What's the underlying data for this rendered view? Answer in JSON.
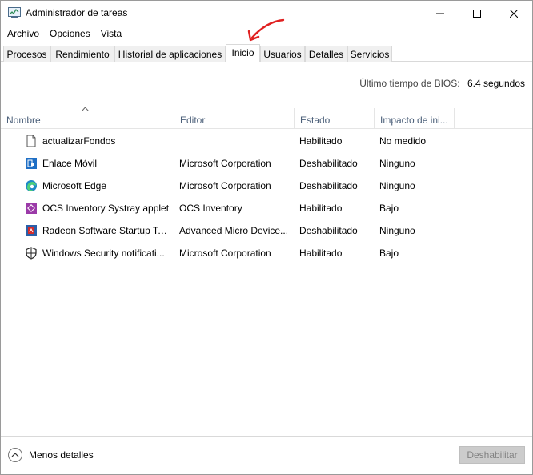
{
  "window": {
    "title": "Administrador de tareas",
    "icon": "task-manager-icon"
  },
  "menu": [
    "Archivo",
    "Opciones",
    "Vista"
  ],
  "tabs": [
    {
      "label": "Procesos"
    },
    {
      "label": "Rendimiento"
    },
    {
      "label": "Historial de aplicaciones"
    },
    {
      "label": "Inicio",
      "active": true
    },
    {
      "label": "Usuarios"
    },
    {
      "label": "Detalles"
    },
    {
      "label": "Servicios"
    }
  ],
  "bios": {
    "label": "Último tiempo de BIOS:",
    "value": "6.4 segundos"
  },
  "table": {
    "columns": [
      "Nombre",
      "Editor",
      "Estado",
      "Impacto de ini..."
    ],
    "rows": [
      {
        "icon": "blank-file-icon",
        "name": "actualizarFondos",
        "publisher": "",
        "state": "Habilitado",
        "impact": "No medido"
      },
      {
        "icon": "phone-link-icon",
        "name": "Enlace Móvil",
        "publisher": "Microsoft Corporation",
        "state": "Deshabilitado",
        "impact": "Ninguno"
      },
      {
        "icon": "edge-icon",
        "name": "Microsoft Edge",
        "publisher": "Microsoft Corporation",
        "state": "Deshabilitado",
        "impact": "Ninguno"
      },
      {
        "icon": "ocs-inventory-icon",
        "name": "OCS Inventory Systray applet",
        "publisher": "OCS Inventory",
        "state": "Habilitado",
        "impact": "Bajo"
      },
      {
        "icon": "radeon-icon",
        "name": "Radeon Software Startup Task",
        "publisher": "Advanced Micro Device...",
        "state": "Deshabilitado",
        "impact": "Ninguno"
      },
      {
        "icon": "windows-security-icon",
        "name": "Windows Security notificati...",
        "publisher": "Microsoft Corporation",
        "state": "Habilitado",
        "impact": "Bajo"
      }
    ]
  },
  "footer": {
    "less_details": "Menos detalles",
    "disable_button": "Deshabilitar"
  },
  "colors": {
    "annotation_arrow": "#e02020",
    "header_text": "#4c607a"
  }
}
